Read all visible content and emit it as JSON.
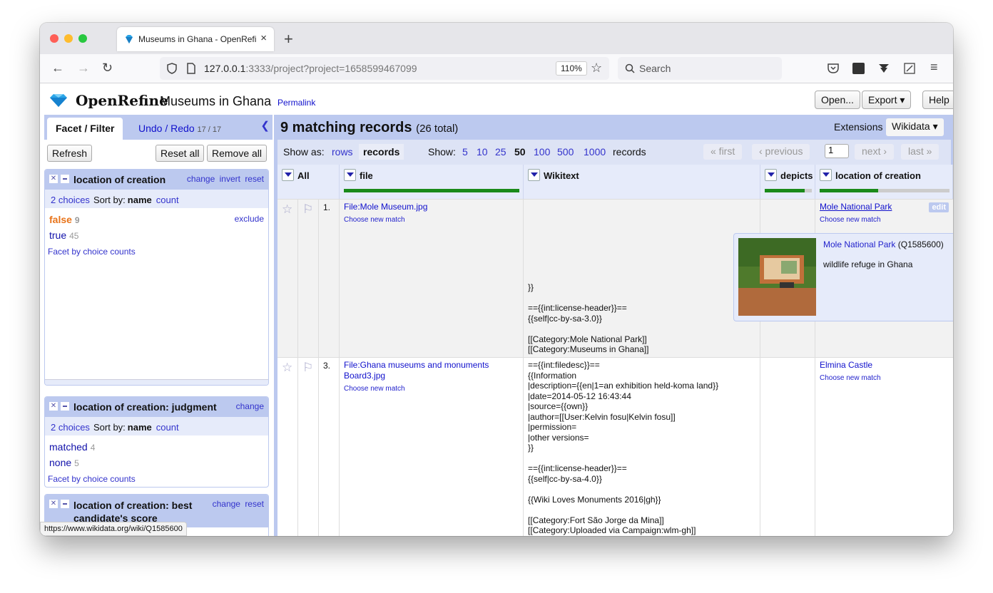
{
  "browser": {
    "tab_title": "Museums in Ghana - OpenRefine",
    "url_host": "127.0.0.1",
    "url_rest": ":3333/project?project=1658599467099",
    "zoom": "110%",
    "search_placeholder": "Search",
    "status_url": "https://www.wikidata.org/wiki/Q1585600"
  },
  "header": {
    "brand": "OpenRefine",
    "project_name": "Museums in Ghana",
    "permalink": "Permalink",
    "open_label": "Open...",
    "export_label": "Export ▾",
    "help_label": "Help"
  },
  "left": {
    "tab_facet": "Facet / Filter",
    "tab_undo": "Undo / Redo",
    "undo_count": "17 / 17",
    "refresh": "Refresh",
    "reset_all": "Reset all",
    "remove_all": "Remove all",
    "facets": [
      {
        "title": "location of creation",
        "links": [
          "change",
          "invert",
          "reset"
        ],
        "choices_label": "2 choices",
        "sort_by": "Sort by:",
        "sort_name": "name",
        "sort_count": "count",
        "items": [
          {
            "label": "false",
            "count": "9",
            "action": "exclude"
          },
          {
            "label": "true",
            "count": "45"
          }
        ],
        "facet_by_counts": "Facet by choice counts"
      },
      {
        "title": "location of creation: judgment",
        "links": [
          "change"
        ],
        "choices_label": "2 choices",
        "sort_by": "Sort by:",
        "sort_name": "name",
        "sort_count": "count",
        "items": [
          {
            "label": "matched",
            "count": "4"
          },
          {
            "label": "none",
            "count": "5"
          }
        ],
        "facet_by_counts": "Facet by choice counts"
      },
      {
        "title": "location of creation: best candidate's score",
        "title_line1": "location of creation: best",
        "title_line2": "candidate's score",
        "links": [
          "change",
          "reset"
        ]
      }
    ]
  },
  "right": {
    "title": "9 matching records",
    "total": "(26 total)",
    "extensions": "Extensions",
    "wikidata": "Wikidata ▾",
    "show_as": "Show as:",
    "rows": "rows",
    "records": "records",
    "show": "Show:",
    "page_sizes": [
      "5",
      "10",
      "25",
      "50",
      "100",
      "500",
      "1000"
    ],
    "page_size_selected": "50",
    "records_word": "records",
    "first": "« first",
    "previous": "‹ previous",
    "page": "1",
    "next": "next ›",
    "last": "last »",
    "columns": [
      "All",
      "file",
      "Wikitext",
      "depicts",
      "location of creation"
    ]
  },
  "rows": [
    {
      "num": "1.",
      "file": "File:Mole Museum.jpg",
      "file_match": "Choose new match",
      "wikitext": "}}\n\n=={{int:license-header}}==\n{{self|cc-by-sa-3.0}}\n\n[[Category:Mole National Park]]\n[[Category:Museums in Ghana]]",
      "location": "Mole National Park",
      "location_match": "Choose new match",
      "edit": "edit"
    },
    {
      "num": "3.",
      "file": "File:Ghana museums and monuments Board3.jpg",
      "file_match": "Choose new match",
      "wikitext": "=={{int:filedesc}}==\n{{Information\n|description={{en|1=an exhibition held-koma land}}\n|date=2014-05-12 16:43:44\n|source={{own}}\n|author=[[User:Kelvin fosu|Kelvin fosu]]\n|permission=\n|other versions=\n}}\n\n=={{int:license-header}}==\n{{self|cc-by-sa-4.0}}\n\n{{Wiki Loves Monuments 2016|gh}}\n\n[[Category:Fort São Jorge da Mina]]\n[[Category:Uploaded via Campaign:wlm-gh]]",
      "location": "Elmina Castle",
      "location_match": "Choose new match"
    }
  ],
  "popup": {
    "name": "Mole National Park",
    "qid": "(Q1585600)",
    "description": "wildlife refuge in Ghana"
  },
  "colors": {
    "accent": "#bcc9ef",
    "link": "#3333cc",
    "match_bar": "#1a8a1a",
    "false_choice": "#e8741a"
  },
  "column_match_fractions": {
    "file": 1.0,
    "depicts": 0.85,
    "location_of_creation": 0.45
  }
}
